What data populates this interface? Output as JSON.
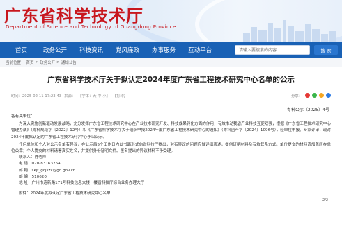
{
  "header": {
    "title": "广东省科学技术厅",
    "subtitle": "Department of Science and Technology of Guangdong Province"
  },
  "nav": {
    "items": [
      "首页",
      "政务公开",
      "科技资讯",
      "党风廉政",
      "办事服务",
      "互动平台"
    ],
    "search_placeholder": "请输入要搜索的内容",
    "search_button": "搜 索"
  },
  "breadcrumb": {
    "label": "当前位置：",
    "items": [
      "首页",
      "政务公开",
      "通知公告"
    ],
    "separator": ">"
  },
  "article": {
    "title": "广东省科学技术厅关于拟认定2024年度广东省工程技术研究中心名单的公示",
    "meta": {
      "date": "时间：2025-02-11 17:23:43",
      "source": "来源：",
      "font_size": "【字体：大  中  小】",
      "print": "【打印】",
      "share_label": "分享："
    },
    "doc_number": "粤科公示〔2025〕4号",
    "salutation": "各有关单位：",
    "paragraphs": [
      "为深入实施创新驱动发展战略，充分发挥广东省工程技术研究中心在产业技术研究开发、科技成果转化方面的作用，有效推动我省产业科技互促双强，根据《广东省工程技术研究中心管理办法》（粤科规范字〔2022〕12号）和《广东省科学技术厅关于组织申报2024年度广东省工程技术研究中心的通知》（粤科函产字〔2024〕1096号），经单位申报、专家评审，现对2024年度拟认定的广东省工程技术研究中心予以公示。",
      "任何单位和个人对公示名单有异议，在公示后5个工作日内以书面形式向省科技厅提出，对有异议的问题应做详细表述，提供证明材料及有效联系方式。单位提交的材料请加盖所在单位公章；个人提交的材料请署真实姓名，并提供身份证明文件。匿名提出的异议材料不予受理。"
    ],
    "contact": {
      "person": "联系人：肖老师",
      "phone": "电 话：020-83163264",
      "email": "邮 箱：skjt_gcjszx@gd.gov.cn",
      "postcode": "邮 编：510620",
      "address": "地 址：广州市连新路171号科技信息大楼一楼省科技厅综合业务办理大厅"
    },
    "attachment": "附件：2024年度拟认定广东省工程技术研究中心名单",
    "page_indicator": "2/2"
  },
  "colors": {
    "brand_red": "#c8171e",
    "nav_blue": "#1961b5",
    "share_icons": [
      "#e53935",
      "#3ab54a",
      "#f5a623",
      "#2d7be5"
    ]
  },
  "share_icons": [
    "weibo-icon",
    "wechat-icon",
    "qzone-icon",
    "qq-icon"
  ]
}
